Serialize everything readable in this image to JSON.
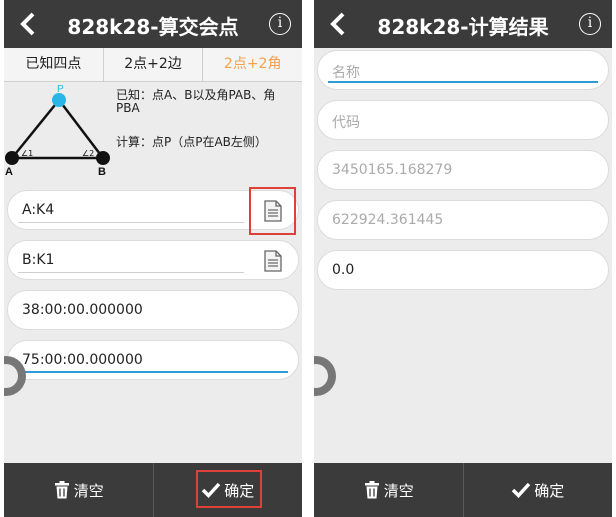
{
  "left_screen": {
    "title": "828k28-算交会点",
    "info_glyph": "i",
    "tabs": [
      "已知四点",
      "2点+2边",
      "2点+2角"
    ],
    "active_tab": 2,
    "diagram": {
      "point_p": "P",
      "point_a": "A",
      "point_b": "B",
      "angle_a": "∠1",
      "angle_b": "∠2"
    },
    "known_text": "已知：点A、B以及角PAB、角PBA",
    "calc_text": "计算：点P（点P在AB左侧）",
    "fields": {
      "point_a": "A:K4",
      "point_b": "B:K1",
      "angle1": "38:00:00.000000",
      "angle2": "75:00:00.000000"
    },
    "clear_label": "清空",
    "confirm_label": "确定"
  },
  "right_screen": {
    "title": "828k28-计算结果",
    "info_glyph": "i",
    "name_placeholder": "名称",
    "code_placeholder": "代码",
    "x_value": "3450165.168279",
    "y_value": "622924.361445",
    "h_value": "0.0",
    "clear_label": "清空",
    "confirm_label": "确定"
  },
  "colors": {
    "titlebar": "#3b3b3b",
    "active_tab": "#f5a04c",
    "highlight": "#e0403a",
    "point_p": "#29b6e6",
    "focus_line": "#2f9bd6"
  }
}
